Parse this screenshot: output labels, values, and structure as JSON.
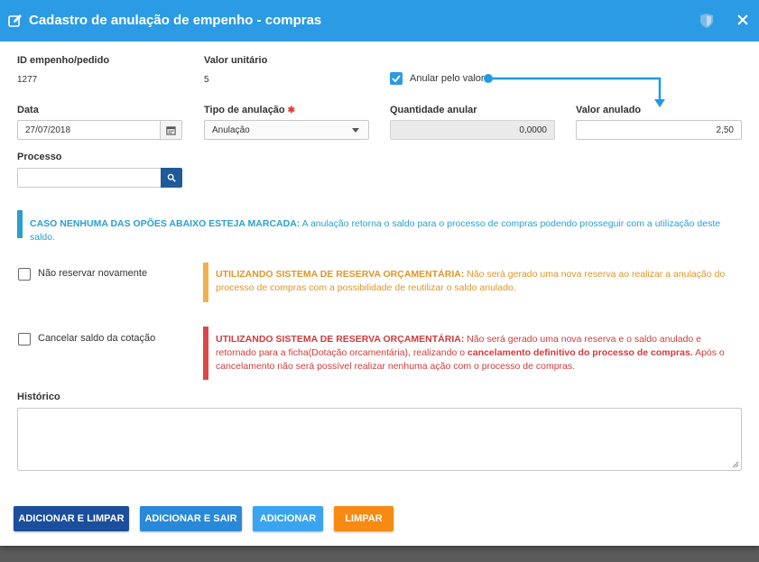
{
  "modal": {
    "title": "Cadastro de anulação de empenho - compras"
  },
  "fields": {
    "id_label": "ID empenho/pedido",
    "id_value": "1277",
    "unit_value_label": "Valor unitário",
    "unit_value": "5",
    "anular_pelo_valor_label": "Anular pelo valor",
    "anular_pelo_valor_checked": true,
    "data_label": "Data",
    "data_value": "27/07/2018",
    "tipo_label": "Tipo de anulação",
    "tipo_required": "✱",
    "tipo_value": "Anulação",
    "quantidade_label": "Quantidade anular",
    "quantidade_value": "0,0000",
    "valor_anulado_label": "Valor anulado",
    "valor_anulado_value": "2,50",
    "processo_label": "Processo",
    "processo_value": "",
    "historico_label": "Histórico"
  },
  "notes": {
    "info_bold": "CASO NENHUMA DAS OPÕES ABAIXO ESTEJA MARCADA:",
    "info_text": " A anulação retorna o saldo para o processo de compras podendo prosseguir com a utilização deste saldo.",
    "warn_bold": "UTILIZANDO SISTEMA DE RESERVA ORÇAMENTÁRIA:",
    "warn_text": " Não será gerado uma nova reserva ao realizar a anulação do processo de compras com a possibilidade de reutilizar o saldo anulado.",
    "danger_bold": "UTILIZANDO SISTEMA DE RESERVA ORÇAMENTÁRIA:",
    "danger_text1": " Não será gerado uma nova reserva e o saldo anulado e retornado para a ficha(Dotação orcamentária), realizando o ",
    "danger_bold2": "cancelamento definitivo do processo de compras.",
    "danger_text2": " Após o cancelamento não será possível realizar nenhuma ação com o processo de compras."
  },
  "options": {
    "nao_reservar_label": "Não reservar novamente",
    "nao_reservar_checked": false,
    "cancelar_saldo_label": "Cancelar saldo da cotação",
    "cancelar_saldo_checked": false
  },
  "buttons": {
    "add_clear": "ADICIONAR E LIMPAR",
    "add_exit": "ADICIONAR E SAIR",
    "add": "ADICIONAR",
    "clear": "LIMPAR"
  },
  "colors": {
    "header": "#2a9be4",
    "info": "#2a9fcf",
    "warning": "#e0962a",
    "danger": "#d23b3b",
    "btn_add_clear": "#1b4e9b",
    "btn_add_exit": "#2a88d8",
    "btn_add": "#3aa5ee",
    "btn_clear": "#f68a12",
    "annotation_arrow": "#1e9be6"
  },
  "icons": {
    "header_edit": "edit-icon",
    "header_shield": "shield-icon",
    "header_close": "close-icon",
    "calendar": "calendar-icon",
    "search": "search-icon",
    "select": "chevron-down-icon"
  }
}
